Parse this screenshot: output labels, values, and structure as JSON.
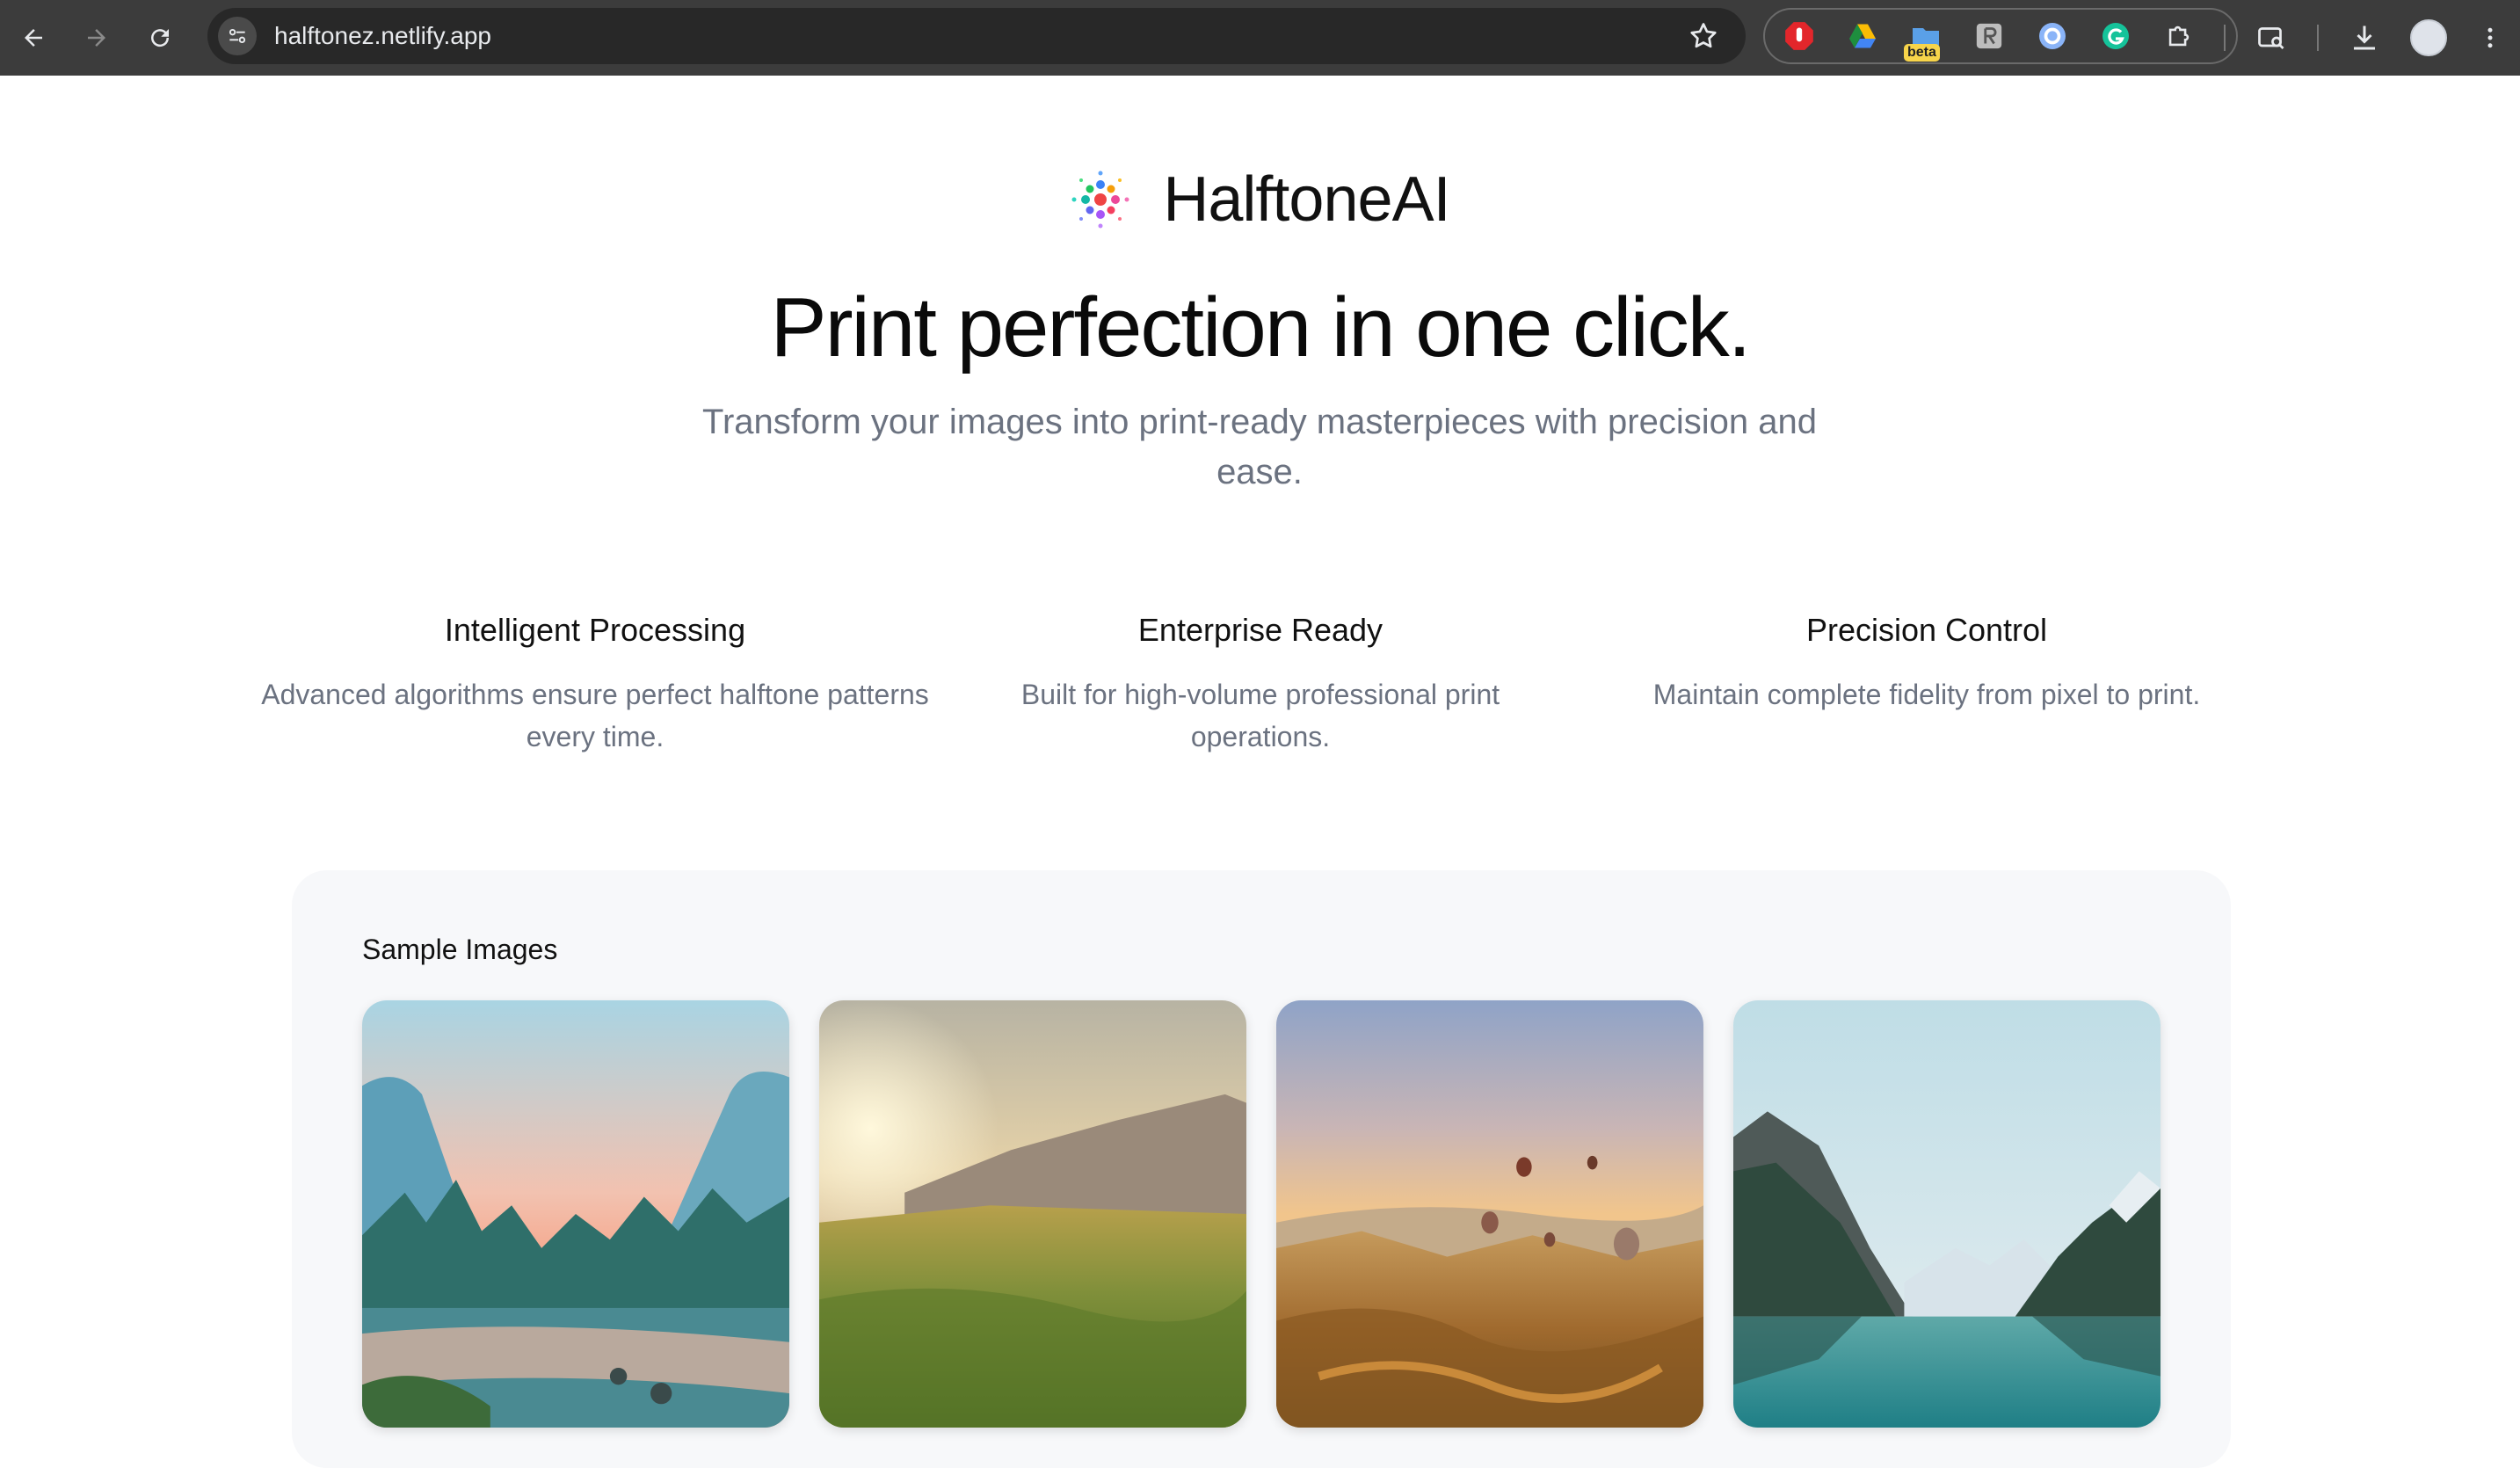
{
  "browser": {
    "url": "halftonez.netlify.app",
    "extension_badge": "beta"
  },
  "brand": {
    "name": "HalftoneAI"
  },
  "hero": {
    "headline": "Print perfection in one click.",
    "subheadline": "Transform your images into print-ready masterpieces with precision and ease."
  },
  "features": [
    {
      "title": "Intelligent Processing",
      "description": "Advanced algorithms ensure perfect halftone patterns every time."
    },
    {
      "title": "Enterprise Ready",
      "description": "Built for high-volume professional print operations."
    },
    {
      "title": "Precision Control",
      "description": "Maintain complete fidelity from pixel to print."
    }
  ],
  "samples": {
    "title": "Sample Images",
    "images": [
      {
        "subject": "mountain valley river at sunset"
      },
      {
        "subject": "grassy meadow with mesa at sunrise"
      },
      {
        "subject": "hot air balloons over canyon"
      },
      {
        "subject": "mountain lake reflection"
      }
    ]
  },
  "colors": {
    "chrome_bg": "#3c3c3c",
    "omnibox_bg": "#282828",
    "muted_text": "#6b7280",
    "samples_bg": "#f7f8fa"
  }
}
